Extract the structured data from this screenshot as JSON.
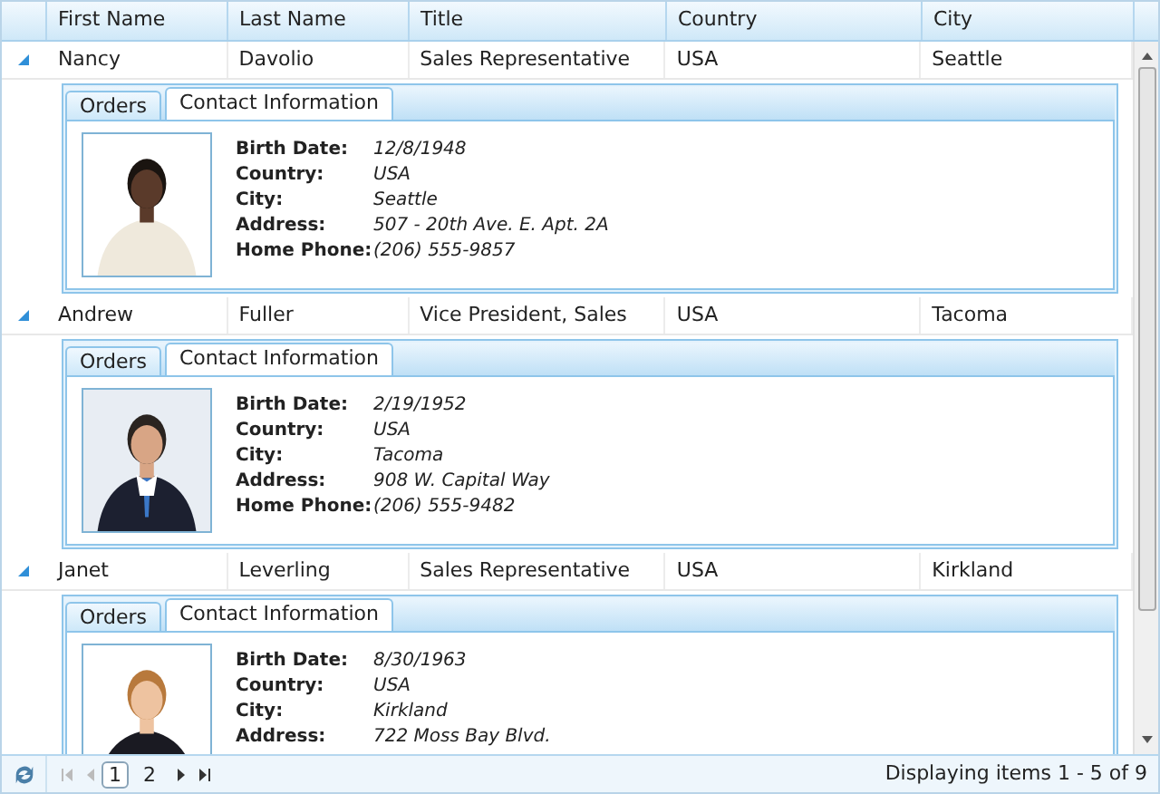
{
  "columns": [
    "First Name",
    "Last Name",
    "Title",
    "Country",
    "City"
  ],
  "records": [
    {
      "expanded": true,
      "cells": [
        "Nancy",
        "Davolio",
        "Sales Representative",
        "USA",
        "Seattle"
      ],
      "tabs": [
        {
          "label": "Orders",
          "selected": false
        },
        {
          "label": "Contact Information",
          "selected": true
        }
      ],
      "photo": {
        "kind": "picture"
      },
      "fields": [
        {
          "label": "Birth Date:",
          "value": "12/8/1948"
        },
        {
          "label": "Country:",
          "value": "USA"
        },
        {
          "label": "City:",
          "value": "Seattle"
        },
        {
          "label": "Address:",
          "value": "507 - 20th Ave. E. Apt. 2A"
        },
        {
          "label": "Home Phone:",
          "value": "(206) 555-9857"
        }
      ]
    },
    {
      "expanded": true,
      "cells": [
        "Andrew",
        "Fuller",
        "Vice President, Sales",
        "USA",
        "Tacoma"
      ],
      "tabs": [
        {
          "label": "Orders",
          "selected": false
        },
        {
          "label": "Contact Information",
          "selected": true
        }
      ],
      "photo": {
        "kind": "picture"
      },
      "fields": [
        {
          "label": "Birth Date:",
          "value": "2/19/1952"
        },
        {
          "label": "Country:",
          "value": "USA"
        },
        {
          "label": "City:",
          "value": "Tacoma"
        },
        {
          "label": "Address:",
          "value": "908 W. Capital Way"
        },
        {
          "label": "Home Phone:",
          "value": "(206) 555-9482"
        }
      ]
    },
    {
      "expanded": true,
      "cells": [
        "Janet",
        "Leverling",
        "Sales Representative",
        "USA",
        "Kirkland"
      ],
      "tabs": [
        {
          "label": "Orders",
          "selected": false
        },
        {
          "label": "Contact Information",
          "selected": true
        }
      ],
      "photo": {
        "kind": "picture"
      },
      "fields": [
        {
          "label": "Birth Date:",
          "value": "8/30/1963"
        },
        {
          "label": "Country:",
          "value": "USA"
        },
        {
          "label": "City:",
          "value": "Kirkland"
        },
        {
          "label": "Address:",
          "value": "722 Moss Bay Blvd."
        }
      ]
    }
  ],
  "pager": {
    "pages": [
      {
        "label": "1",
        "selected": true
      },
      {
        "label": "2",
        "selected": false
      }
    ],
    "status": "Displaying items 1 - 5 of 9"
  }
}
